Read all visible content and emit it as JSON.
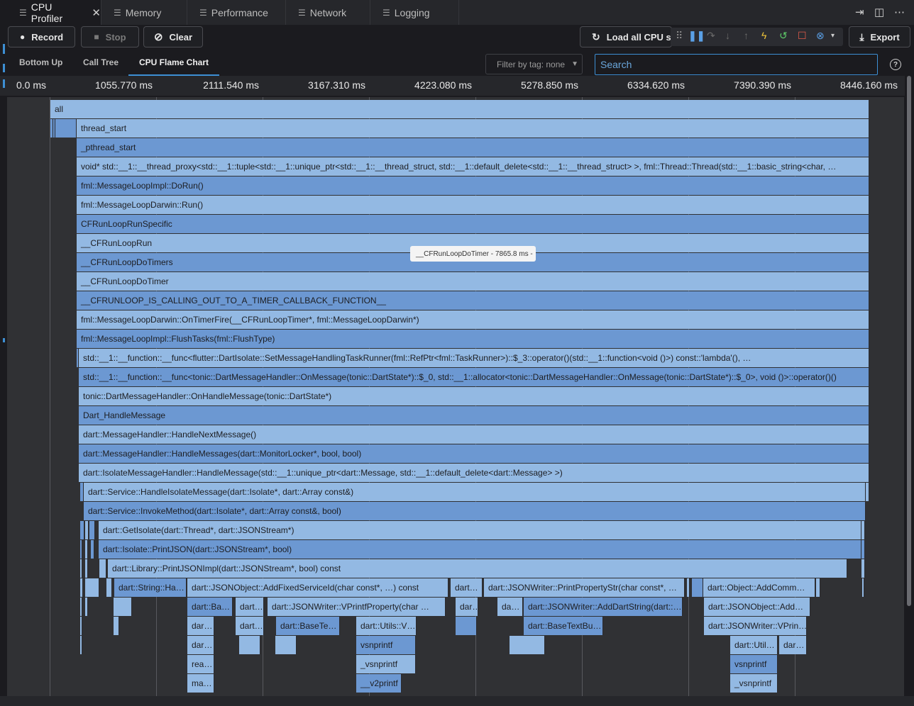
{
  "tabs": [
    {
      "label": "CPU Profiler",
      "active": true
    },
    {
      "label": "Memory"
    },
    {
      "label": "Performance"
    },
    {
      "label": "Network"
    },
    {
      "label": "Logging"
    }
  ],
  "toolbar": {
    "record": "Record",
    "stop": "Stop",
    "clear": "Clear",
    "load_all": "Load all CPU sa",
    "export": "Export"
  },
  "view_tabs": [
    "Bottom Up",
    "Call Tree",
    "CPU Flame Chart"
  ],
  "filter": {
    "label": "Filter by tag: none"
  },
  "search": {
    "placeholder": "Search",
    "value": ""
  },
  "time_axis": [
    "0.0 ms",
    "1055.770 ms",
    "2111.540 ms",
    "3167.310 ms",
    "4223.080 ms",
    "5278.850 ms",
    "6334.620 ms",
    "7390.390 ms",
    "8446.160 ms"
  ],
  "tooltip": "__CFRunLoopDoTimer - 7865.8 ms -",
  "flame": {
    "main_rows": [
      "all",
      "thread_start",
      "_pthread_start",
      "void* std::__1::__thread_proxy<std::__1::tuple<std::__1::unique_ptr<std::__1::__thread_struct, std::__1::default_delete<std::__1::__thread_struct> >, fml::Thread::Thread(std::__1::basic_string<char, …",
      "fml::MessageLoopImpl::DoRun()",
      "fml::MessageLoopDarwin::Run()",
      "CFRunLoopRunSpecific",
      "__CFRunLoopRun",
      "__CFRunLoopDoTimers",
      "__CFRunLoopDoTimer",
      "__CFRUNLOOP_IS_CALLING_OUT_TO_A_TIMER_CALLBACK_FUNCTION__",
      "fml::MessageLoopDarwin::OnTimerFire(__CFRunLoopTimer*, fml::MessageLoopDarwin*)",
      "fml::MessageLoopImpl::FlushTasks(fml::FlushType)",
      "std::__1::__function::__func<flutter::DartIsolate::SetMessageHandlingTaskRunner(fml::RefPtr<fml::TaskRunner>)::$_3::operator()(std::__1::function<void ()>) const::'lambda'(), …",
      "std::__1::__function::__func<tonic::DartMessageHandler::OnMessage(tonic::DartState*)::$_0, std::__1::allocator<tonic::DartMessageHandler::OnMessage(tonic::DartState*)::$_0>, void ()>::operator()()",
      "tonic::DartMessageHandler::OnHandleMessage(tonic::DartState*)",
      "Dart_HandleMessage",
      "dart::MessageHandler::HandleNextMessage()",
      "dart::MessageHandler::HandleMessages(dart::MonitorLocker*, bool, bool)",
      "dart::IsolateMessageHandler::HandleMessage(std::__1::unique_ptr<dart::Message, std::__1::default_delete<dart::Message> >)",
      "dart::Service::HandleIsolateMessage(dart::Isolate*, dart::Array const&)",
      "dart::Service::InvokeMethod(dart::Isolate*, dart::Array const&, bool)",
      "dart::GetIsolate(dart::Thread*, dart::JSONStream*)",
      "dart::Isolate::PrintJSON(dart::JSONStream*, bool)",
      "dart::Library::PrintJSONImpl(dart::JSONStream*, bool) const"
    ],
    "lower": {
      "r25": [
        "dart::String::Ha…",
        "dart::JSONObject::AddFixedServiceId(char const*, …) const",
        "dart…",
        "dart::JSONWriter::PrintPropertyStr(char const*, …",
        "dart::Object::AddComm…"
      ],
      "r26": [
        "dart::Ba…",
        "dart…",
        "dart::JSONWriter::VPrintfProperty(char …",
        "dar…",
        "da…",
        "dart::JSONWriter::AddDartString(dart::…",
        "dart::JSONObject::Add…"
      ],
      "r27": [
        "dar…",
        "dart…",
        "dart::BaseTe…",
        "dart::Utils::V…",
        "dart::BaseTextBu…",
        "dart::JSONWriter::VPrin…"
      ],
      "r28": [
        "dar…",
        "vsnprintf",
        "dart::Util…",
        "dar…"
      ],
      "r29": [
        "rea…",
        "_vsnprintf",
        "vsnprintf"
      ],
      "r30": [
        "ma…",
        "__v2printf",
        "_vsnprintf"
      ]
    }
  },
  "colors": {
    "light_frame": "#93b9e3",
    "dark_frame": "#6c98d2",
    "accent": "#3d8fd4"
  }
}
